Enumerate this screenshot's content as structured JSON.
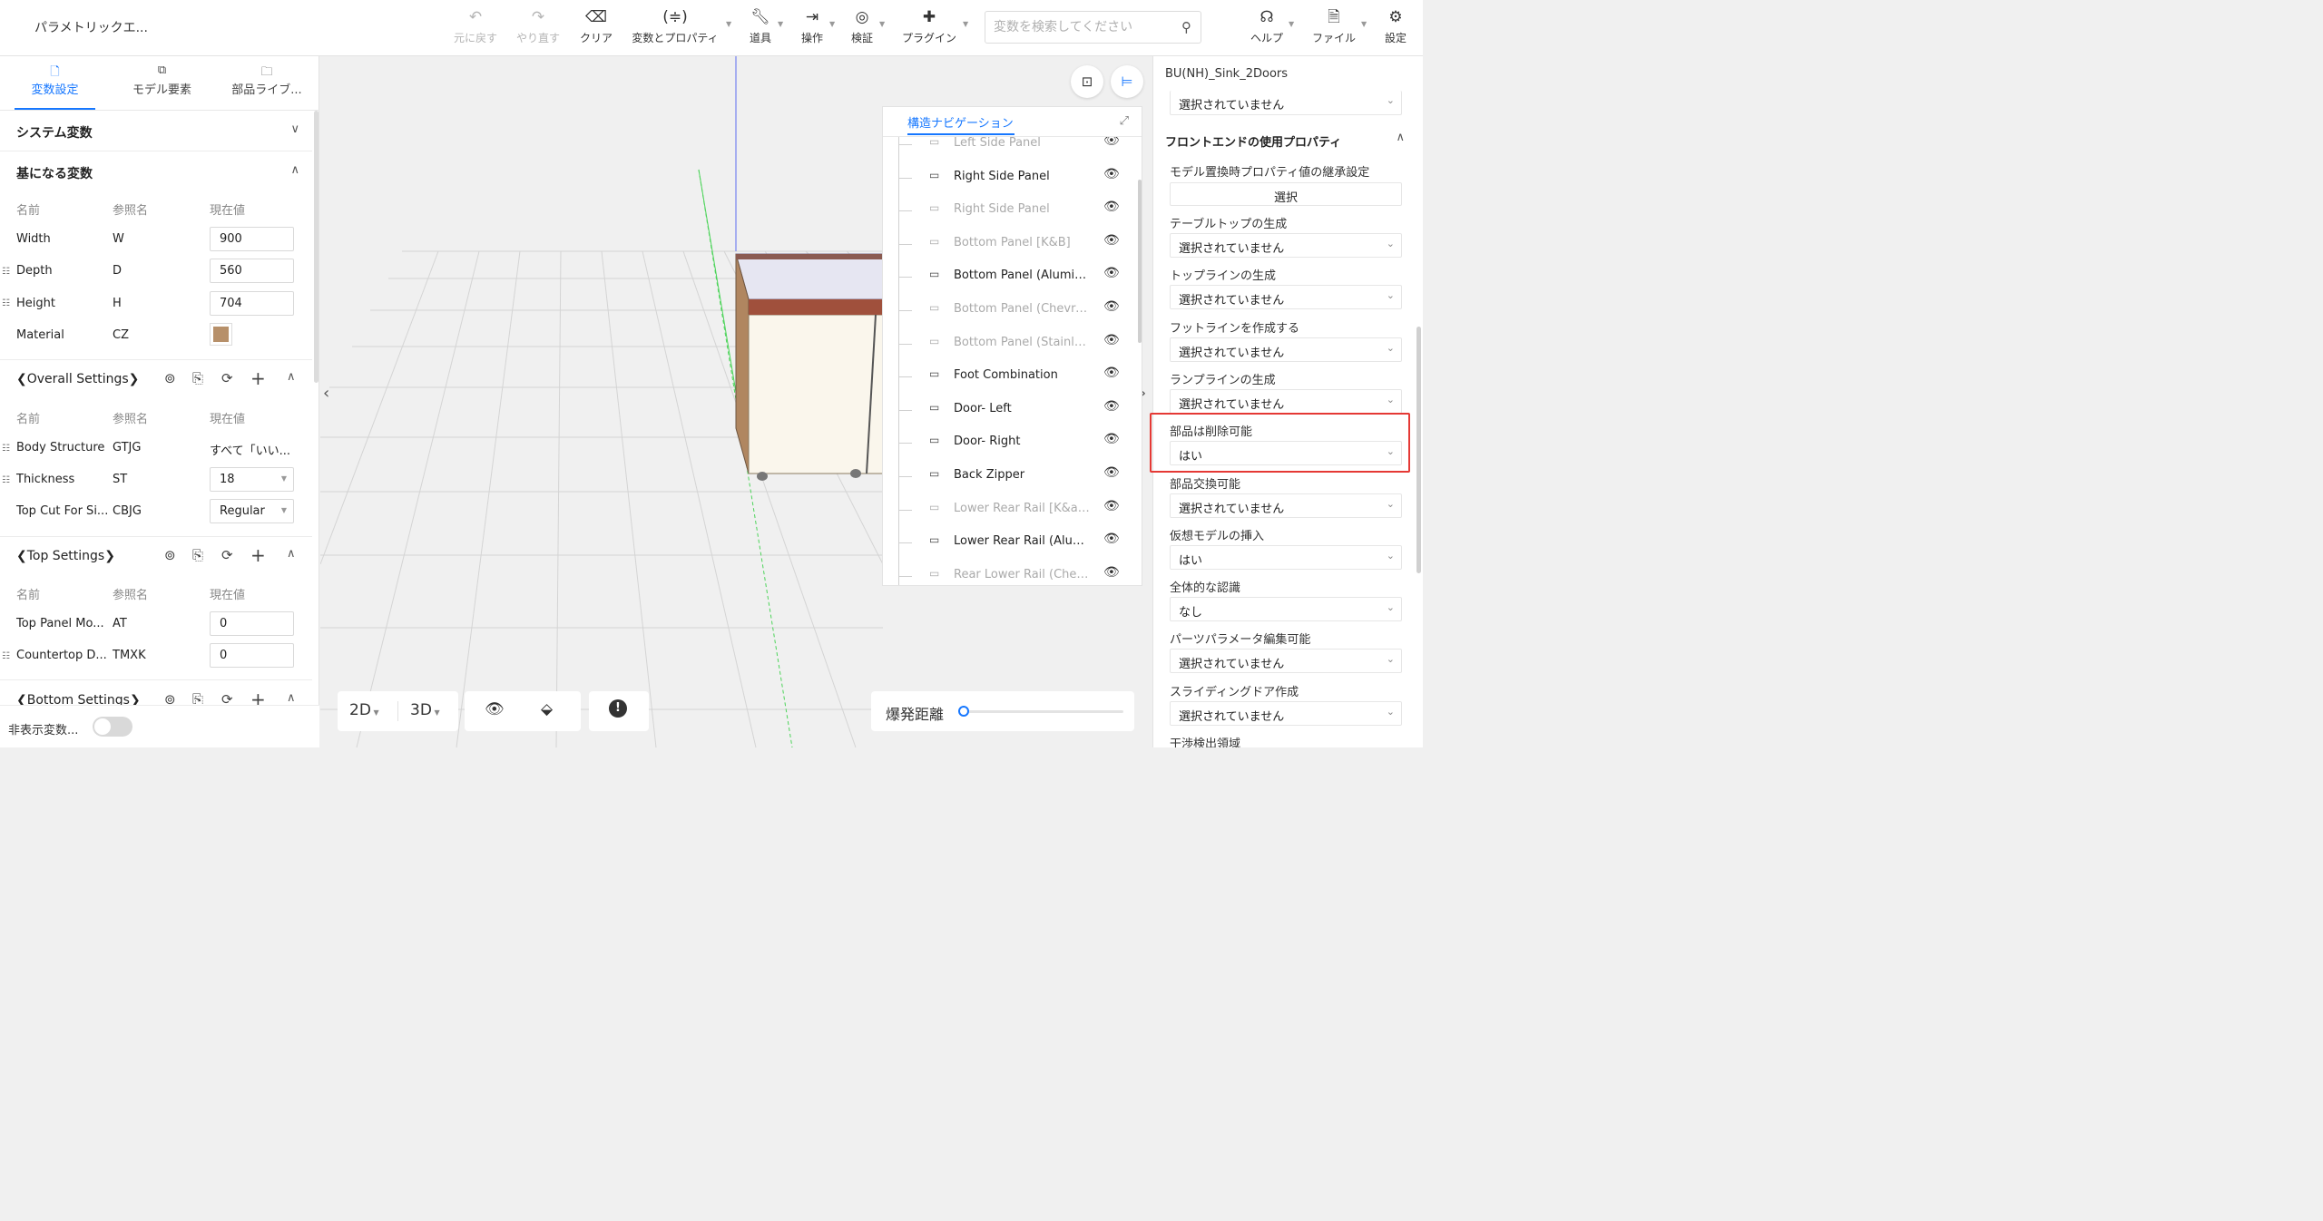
{
  "app": {
    "title": "パラメトリックエ..."
  },
  "toolbar": {
    "undo": "元に戻す",
    "redo": "やり直す",
    "clear": "クリア",
    "variables_props": "変数とプロパティ",
    "tools": "道具",
    "operations": "操作",
    "validate": "検証",
    "plugins": "プラグイン",
    "help": "ヘルプ",
    "file": "ファイル",
    "settings": "設定",
    "search_placeholder": "変数を検索してください"
  },
  "left_tabs": [
    "変数設定",
    "モデル要素",
    "部品ライブ..."
  ],
  "system_vars": {
    "title": "システム変数"
  },
  "base_vars": {
    "title": "基になる変数",
    "headers": [
      "名前",
      "参照名",
      "現在値"
    ],
    "rows": [
      {
        "name": "Width",
        "ref": "W",
        "value": "900"
      },
      {
        "name": "Depth",
        "ref": "D",
        "value": "560"
      },
      {
        "name": "Height",
        "ref": "H",
        "value": "704"
      },
      {
        "name": "Material",
        "ref": "CZ",
        "value": ""
      }
    ]
  },
  "overall": {
    "title": "❮Overall Settings❯",
    "headers": [
      "名前",
      "参照名",
      "現在値"
    ],
    "rows": [
      {
        "name": "Body Structure",
        "ref": "GTJG",
        "value": "すべて「いい..."
      },
      {
        "name": "Thickness",
        "ref": "ST",
        "value": "18"
      },
      {
        "name": "Top Cut For Si...",
        "ref": "CBJG",
        "value": "Regular"
      }
    ]
  },
  "top": {
    "title": "❮Top Settings❯",
    "headers": [
      "名前",
      "参照名",
      "現在値"
    ],
    "rows": [
      {
        "name": "Top Panel Mo...",
        "ref": "AT",
        "value": "0"
      },
      {
        "name": "Countertop D...",
        "ref": "TMXK",
        "value": "0"
      }
    ]
  },
  "bottom": {
    "title": "❮Bottom Settings❯"
  },
  "hidden_vars_label": "非表示変数...",
  "view_buttons": {
    "mode2d": "2D",
    "mode3d": "3D"
  },
  "explode": {
    "label": "爆発距離",
    "value": 0
  },
  "nav": {
    "title": "構造ナビゲーション",
    "items": [
      {
        "label": "Left Side Panel",
        "dim": true
      },
      {
        "label": "Right Side Panel",
        "dim": false
      },
      {
        "label": "Right Side Panel",
        "dim": true
      },
      {
        "label": "Bottom Panel [K&B]",
        "dim": true
      },
      {
        "label": "Bottom Panel (Aluminu...",
        "dim": false
      },
      {
        "label": "Bottom Panel (Chevron)",
        "dim": true
      },
      {
        "label": "Bottom Panel (Stainless ...",
        "dim": true
      },
      {
        "label": "Foot Combination",
        "dim": false
      },
      {
        "label": "Door- Left",
        "dim": false
      },
      {
        "label": "Door- Right",
        "dim": false
      },
      {
        "label": "Back Zipper",
        "dim": false
      },
      {
        "label": "Lower Rear Rail [K&amp;...",
        "dim": true
      },
      {
        "label": "Lower Rear Rail (Alumin...",
        "dim": false
      },
      {
        "label": "Rear Lower Rail (Chevron)",
        "dim": true
      }
    ]
  },
  "right": {
    "model_name": "BU(NH)_Sink_2Doors",
    "top_select": "選択されていません",
    "section_title": "フロントエンドの使用プロパティ",
    "inherit_label": "モデル置換時プロパティ値の継承設定",
    "inherit_button": "選択",
    "props": [
      {
        "label": "テーブルトップの生成",
        "value": "選択されていません"
      },
      {
        "label": "トップラインの生成",
        "value": "選択されていません"
      },
      {
        "label": "フットラインを作成する",
        "value": "選択されていません"
      },
      {
        "label": "ランプラインの生成",
        "value": "選択されていません"
      },
      {
        "label": "部品は削除可能",
        "value": "はい"
      },
      {
        "label": "部品交換可能",
        "value": "選択されていません"
      },
      {
        "label": "仮想モデルの挿入",
        "value": "はい"
      },
      {
        "label": "全体的な認識",
        "value": "なし"
      },
      {
        "label": "パーツパラメータ編集可能",
        "value": "選択されていません"
      },
      {
        "label": "スライディングドア作成",
        "value": "選択されていません"
      },
      {
        "label": "干渉検出領域",
        "value": ""
      }
    ]
  }
}
